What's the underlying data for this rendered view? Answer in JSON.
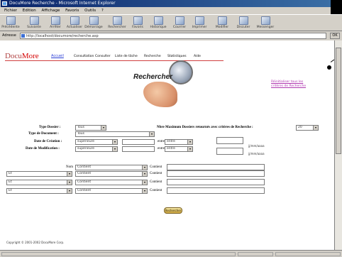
{
  "window": {
    "title": "DocuMore Recherche - Microsoft Internet Explorer",
    "menu": [
      "Fichier",
      "Edition",
      "Affichage",
      "Favoris",
      "Outils",
      "?"
    ],
    "toolbar": [
      "Précédente",
      "Suivante",
      "Arrêter",
      "Actualiser",
      "Démarrage",
      "Rechercher",
      "Favoris",
      "Historique",
      "Courrier",
      "Imprimer",
      "Modifier",
      "Discuter",
      "Messenger"
    ],
    "address_label": "Adresse",
    "address": "http://localhost/documore/recherche.asp",
    "go_label": "OK"
  },
  "brand": {
    "part1": "Docu",
    "part2": "More"
  },
  "nav": {
    "current": "Accueil",
    "links": [
      "Consultation",
      "Consulter",
      "Liste de tâche",
      "Recherche",
      "Statistiques",
      "Aide"
    ]
  },
  "hero": {
    "title": "Rechercher"
  },
  "side_link": "Réinitialiser tous les critères de Recherche",
  "form": {
    "type_label": "Type Dossier :",
    "type_value": "Tous",
    "max_label": "Nbre Maximum Dossiers retournés avec critères de Recherche :",
    "max_value": "20",
    "doc_type_label": "Type de Document :",
    "doc_type_value": "Tous",
    "creation_label": "Date de Création :",
    "creation_from": "supérieure",
    "creation_op": "entre",
    "creation_to": "entre",
    "modif_label": "Date de Modification :",
    "modif_from": "supérieure",
    "modif_op": "entre",
    "modif_to": "entre",
    "date_hint": "jj/mm/aaaa",
    "rows": [
      {
        "label": "Nom",
        "field": "Contient",
        "op": "Contient"
      },
      {
        "label": "Et",
        "field": "Contient",
        "op": "Contient"
      },
      {
        "label": "Et",
        "field": "Contient",
        "op": "Contient"
      },
      {
        "label": "Et",
        "field": "Contient",
        "op": "Contient"
      }
    ],
    "submit": "Rechercher"
  },
  "footer": "Copyright © 2001-2002 DocuMore Corp.",
  "colors": {
    "brand": "#d40000",
    "link": "#2b3fd6",
    "side_link": "#b038b0",
    "rule": "#d04040"
  }
}
